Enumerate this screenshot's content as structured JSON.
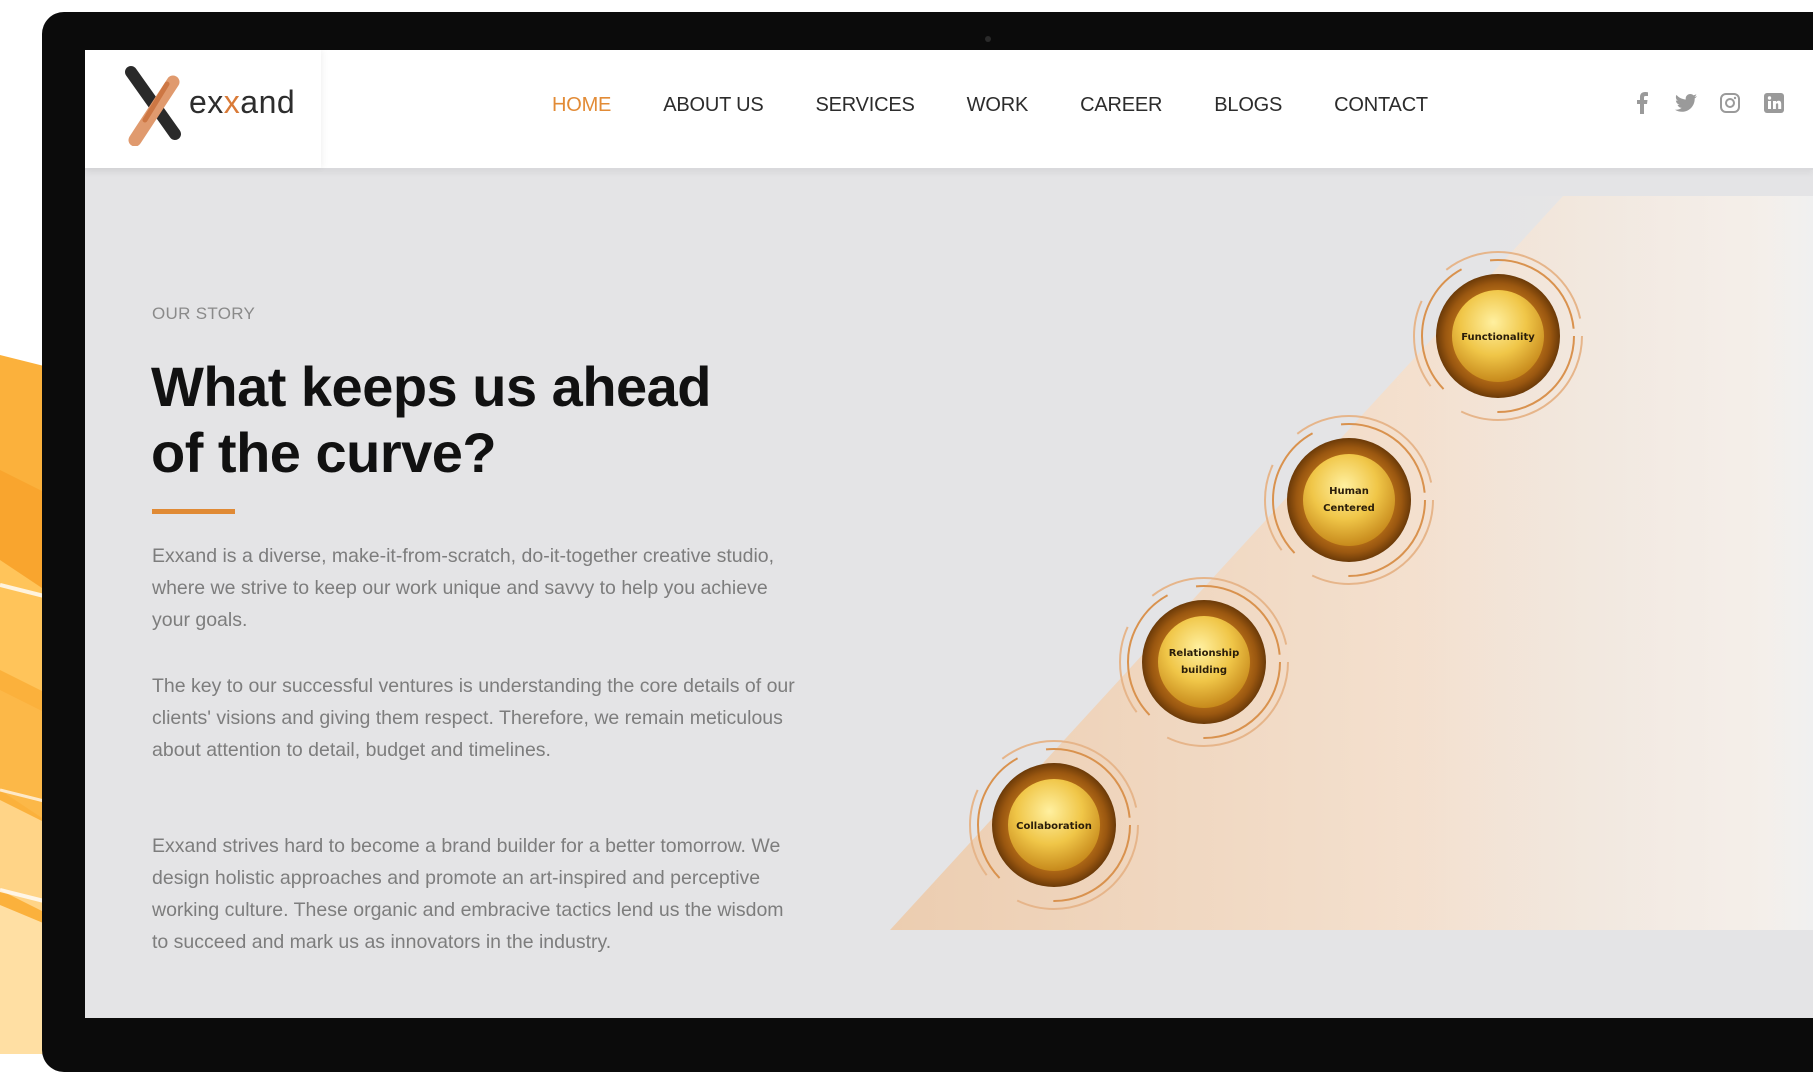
{
  "brand": {
    "logo_text_pre": "ex",
    "logo_text_accent": "x",
    "logo_text_post": "and",
    "accent_color": "#e08a35"
  },
  "nav": {
    "items": [
      {
        "label": "HOME",
        "active": true
      },
      {
        "label": "ABOUT US",
        "active": false
      },
      {
        "label": "SERVICES",
        "active": false
      },
      {
        "label": "WORK",
        "active": false
      },
      {
        "label": "CAREER",
        "active": false
      },
      {
        "label": "BLOGS",
        "active": false
      },
      {
        "label": "CONTACT",
        "active": false
      }
    ]
  },
  "socials": [
    "facebook-icon",
    "twitter-icon",
    "instagram-icon",
    "linkedin-icon"
  ],
  "story": {
    "eyebrow": "OUR STORY",
    "headline_line1": "What keeps us ahead",
    "headline_line2": "of the curve?",
    "paragraph1": "Exxand is a diverse, make-it-from-scratch, do-it-together creative studio, where we strive to keep our work unique and savvy to help you achieve your goals.",
    "paragraph2": "The key to our successful ventures is understanding the core details of our clients' visions and giving them respect. Therefore, we remain meticulous about attention to detail, budget and timelines.",
    "paragraph3": "Exxand strives hard to become a brand builder for a better tomorrow. We design holistic approaches and promote an art-inspired and perceptive working culture. These organic and embracive tactics lend us the wisdom to succeed and mark us as innovators in the industry."
  },
  "values_diagram": {
    "nodes": [
      {
        "lines": [
          "Collaboration"
        ]
      },
      {
        "lines": [
          "Relationship",
          "building"
        ]
      },
      {
        "lines": [
          "Human",
          "Centered"
        ]
      },
      {
        "lines": [
          "Functionality"
        ]
      }
    ]
  }
}
